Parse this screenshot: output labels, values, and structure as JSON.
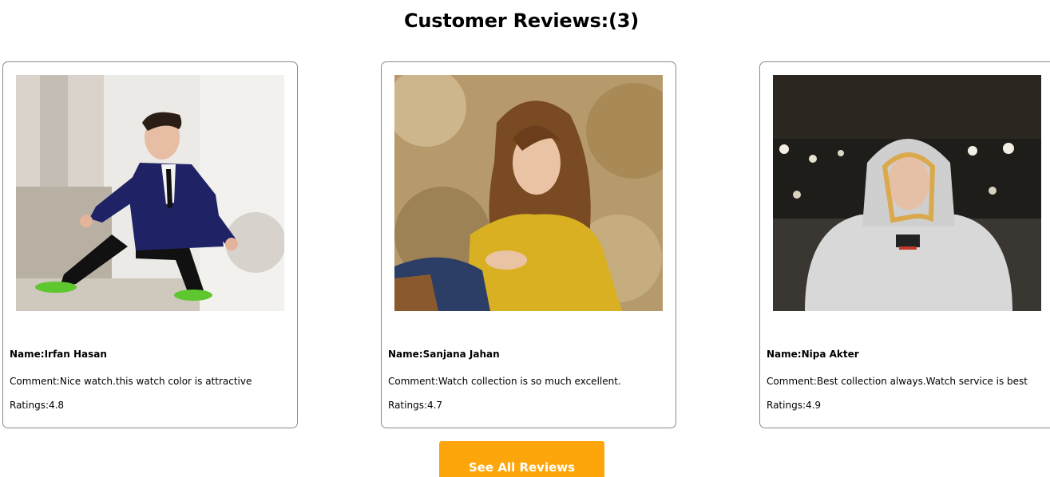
{
  "section": {
    "title": "Customer Reviews:(3)"
  },
  "reviews": [
    {
      "name": "Name:Irfan Hasan",
      "comment": "Comment:Nice watch.this watch color is attractive",
      "ratings": "Ratings:4.8",
      "photo": "man-in-navy-blazer-photo"
    },
    {
      "name": "Name:Sanjana Jahan",
      "comment": "Comment:Watch collection is so much excellent.",
      "ratings": "Ratings:4.7",
      "photo": "woman-in-yellow-top-photo"
    },
    {
      "name": "Name:Nipa Akter",
      "comment": "Comment:Best collection always.Watch service is best",
      "ratings": "Ratings:4.9",
      "photo": "woman-in-white-hoodie-photo"
    }
  ],
  "button": {
    "label": "See All Reviews"
  },
  "colors": {
    "accent": "#fca60b",
    "card_border": "#8a8a8a",
    "text": "#000000"
  }
}
